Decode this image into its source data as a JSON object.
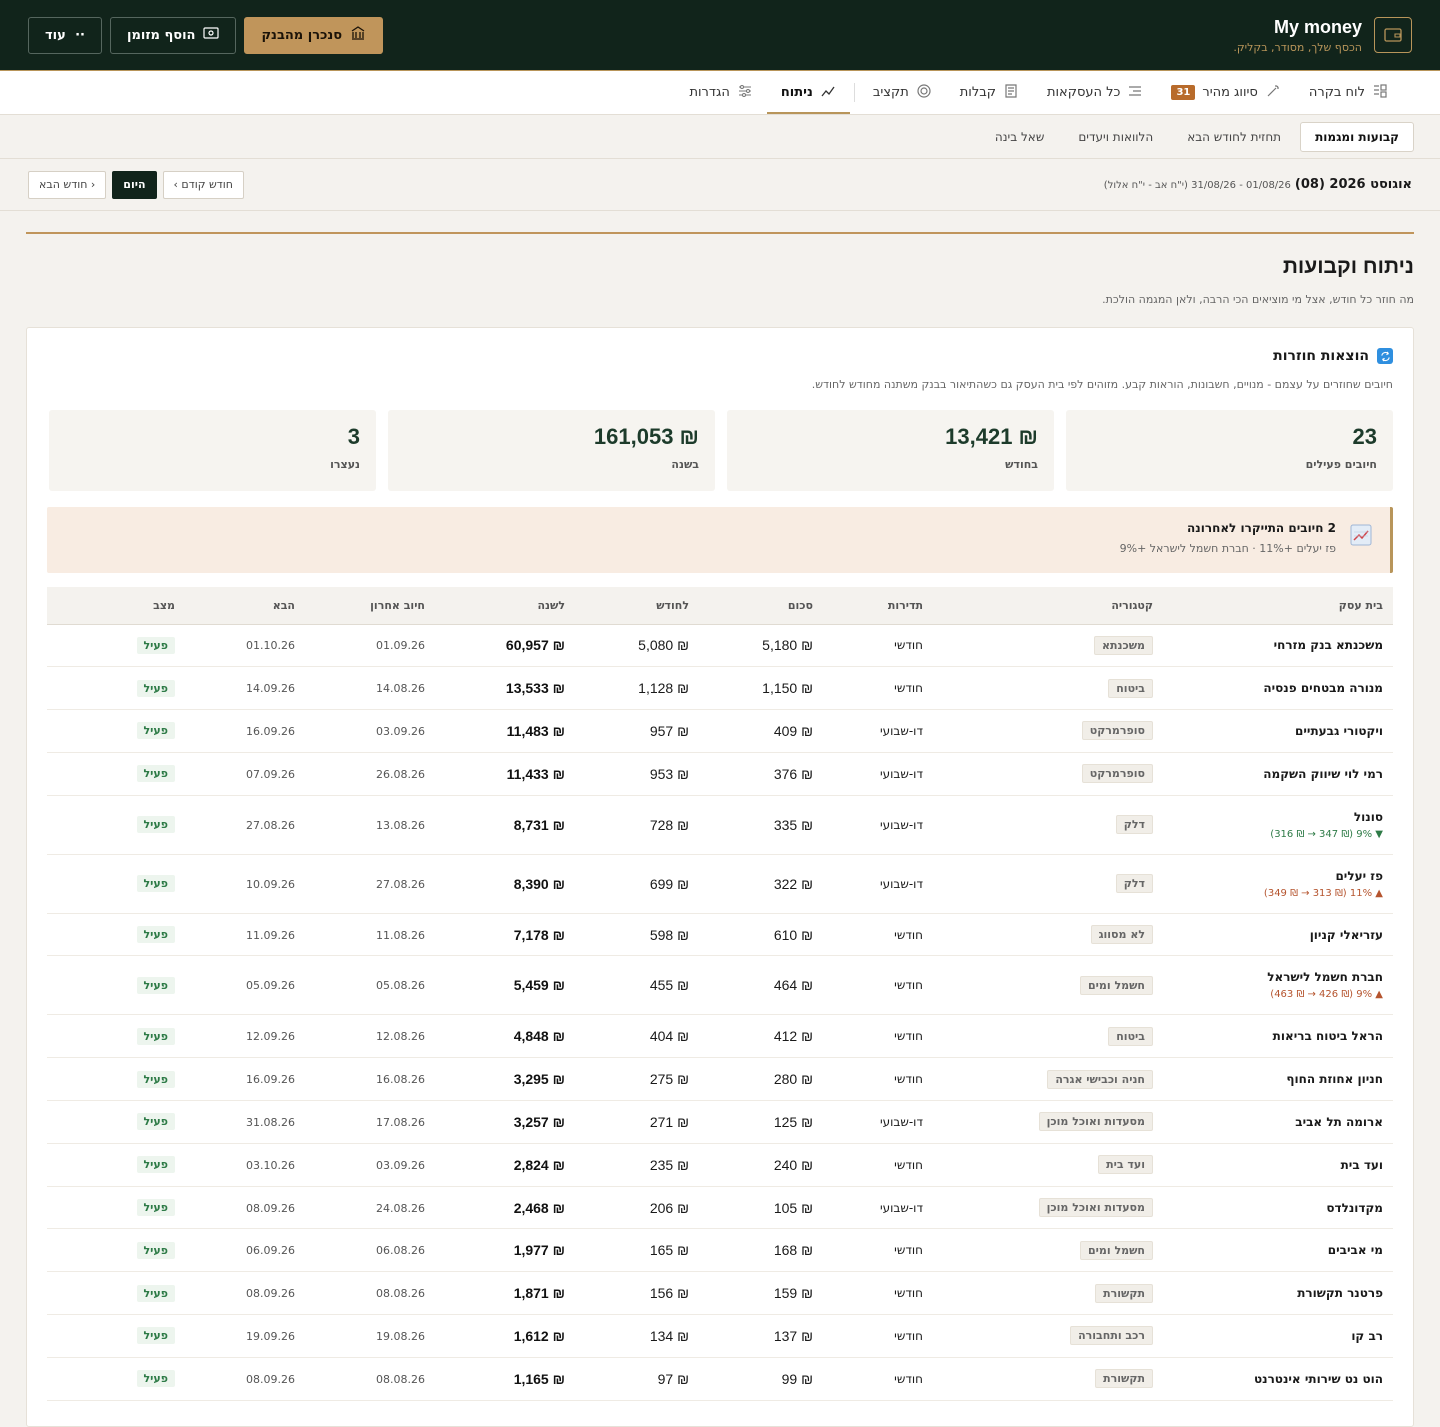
{
  "brand": {
    "title": "My money",
    "subtitle": "הכסף שלך, מסודר, בקליק."
  },
  "actions": {
    "sync": "סנכרן מהבנק",
    "cash": "הוסף מזומן",
    "more": "עוד"
  },
  "nav": {
    "dashboard": "לוח בקרה",
    "quick": "סיווג מהיר",
    "quick_count": "31",
    "all": "כל העסקאות",
    "receipts": "קבלות",
    "budget": "תקציב",
    "analysis": "ניתוח",
    "settings": "הגדרות"
  },
  "subnav": {
    "fixed": "קבועות ומגמות",
    "forecast": "תחזית לחודש הבא",
    "loans": "הלוואות ויעדים",
    "ask": "שאל בינה"
  },
  "datebar": {
    "month": "אוגוסט 2026 (08)",
    "range": "01/08/26 - 31/08/26 (י\"ח אב - י\"ח אלול)",
    "prev": "חודש קודם ›",
    "today": "היום",
    "next": "‹ חודש הבא"
  },
  "page": {
    "title": "ניתוח וקבועות",
    "subtitle": "מה חוזר כל חודש, אצל מי מוציאים הכי הרבה, ולאן המגמה הולכת."
  },
  "card": {
    "title": "הוצאות חוזרות",
    "subtitle": "חיובים שחוזרים על עצמם - מנויים, חשבונות, הוראות קבע. מזוהים לפי בית העסק גם כשהתיאור בבנק משתנה מחודש לחודש."
  },
  "stats": [
    {
      "value": "23",
      "label": "חיובים פעילים"
    },
    {
      "value": "₪ 13,421",
      "label": "בחודש"
    },
    {
      "value": "₪ 161,053",
      "label": "בשנה"
    },
    {
      "value": "3",
      "label": "נעצרו"
    }
  ],
  "alert": {
    "title": "2 חיובים התייקרו לאחרונה",
    "detail": "פז יעלים +11% · חברת חשמל לישראל +9%"
  },
  "table": {
    "headers": {
      "merchant": "בית עסק",
      "category": "קטגוריה",
      "freq": "תדירות",
      "amount": "סכום",
      "monthly": "לחודש",
      "yearly": "לשנה",
      "last": "חיוב אחרון",
      "next": "הבא",
      "status": "מצב"
    },
    "rows": [
      {
        "merchant": "משכנתא בנק מזרחי",
        "category": "משכנתא",
        "freq": "חודשי",
        "amount": "₪ 5,180",
        "monthly": "₪ 5,080",
        "yearly": "₪ 60,957",
        "last": "01.09.26",
        "next": "01.10.26",
        "status": "פעיל",
        "change": ""
      },
      {
        "merchant": "מנורה מבטחים פנסיה",
        "category": "ביטוח",
        "freq": "חודשי",
        "amount": "₪ 1,150",
        "monthly": "₪ 1,128",
        "yearly": "₪ 13,533",
        "last": "14.08.26",
        "next": "14.09.26",
        "status": "פעיל",
        "change": ""
      },
      {
        "merchant": "ויקטורי גבעתיים",
        "category": "סופרמרקט",
        "freq": "דו-שבועי",
        "amount": "₪ 409",
        "monthly": "₪ 957",
        "yearly": "₪ 11,483",
        "last": "03.09.26",
        "next": "16.09.26",
        "status": "פעיל",
        "change": ""
      },
      {
        "merchant": "רמי לוי שיווק השקמה",
        "category": "סופרמרקט",
        "freq": "דו-שבועי",
        "amount": "₪ 376",
        "monthly": "₪ 953",
        "yearly": "₪ 11,433",
        "last": "26.08.26",
        "next": "07.09.26",
        "status": "פעיל",
        "change": ""
      },
      {
        "merchant": "סונול",
        "category": "דלק",
        "freq": "דו-שבועי",
        "amount": "₪ 335",
        "monthly": "₪ 728",
        "yearly": "₪ 8,731",
        "last": "13.08.26",
        "next": "27.08.26",
        "status": "פעיל",
        "change": "▼ 9% (₪ 347 → ₪ 316)",
        "dir": "down"
      },
      {
        "merchant": "פז יעלים",
        "category": "דלק",
        "freq": "דו-שבועי",
        "amount": "₪ 322",
        "monthly": "₪ 699",
        "yearly": "₪ 8,390",
        "last": "27.08.26",
        "next": "10.09.26",
        "status": "פעיל",
        "change": "▲ 11% (₪ 313 → ₪ 349)",
        "dir": "up"
      },
      {
        "merchant": "עזריאלי קניון",
        "category": "לא מסווג",
        "freq": "חודשי",
        "amount": "₪ 610",
        "monthly": "₪ 598",
        "yearly": "₪ 7,178",
        "last": "11.08.26",
        "next": "11.09.26",
        "status": "פעיל",
        "change": ""
      },
      {
        "merchant": "חברת חשמל לישראל",
        "category": "חשמל ומים",
        "freq": "חודשי",
        "amount": "₪ 464",
        "monthly": "₪ 455",
        "yearly": "₪ 5,459",
        "last": "05.08.26",
        "next": "05.09.26",
        "status": "פעיל",
        "change": "▲ 9% (₪ 426 → ₪ 463)",
        "dir": "up"
      },
      {
        "merchant": "הראל ביטוח בריאות",
        "category": "ביטוח",
        "freq": "חודשי",
        "amount": "₪ 412",
        "monthly": "₪ 404",
        "yearly": "₪ 4,848",
        "last": "12.08.26",
        "next": "12.09.26",
        "status": "פעיל",
        "change": ""
      },
      {
        "merchant": "חניון אחוזת החוף",
        "category": "חניה וכבישי אגרה",
        "freq": "חודשי",
        "amount": "₪ 280",
        "monthly": "₪ 275",
        "yearly": "₪ 3,295",
        "last": "16.08.26",
        "next": "16.09.26",
        "status": "פעיל",
        "change": ""
      },
      {
        "merchant": "ארומה תל אביב",
        "category": "מסעדות ואוכל מוכן",
        "freq": "דו-שבועי",
        "amount": "₪ 125",
        "monthly": "₪ 271",
        "yearly": "₪ 3,257",
        "last": "17.08.26",
        "next": "31.08.26",
        "status": "פעיל",
        "change": ""
      },
      {
        "merchant": "ועד בית",
        "category": "ועד בית",
        "freq": "חודשי",
        "amount": "₪ 240",
        "monthly": "₪ 235",
        "yearly": "₪ 2,824",
        "last": "03.09.26",
        "next": "03.10.26",
        "status": "פעיל",
        "change": ""
      },
      {
        "merchant": "מקדונלדס",
        "category": "מסעדות ואוכל מוכן",
        "freq": "דו-שבועי",
        "amount": "₪ 105",
        "monthly": "₪ 206",
        "yearly": "₪ 2,468",
        "last": "24.08.26",
        "next": "08.09.26",
        "status": "פעיל",
        "change": ""
      },
      {
        "merchant": "מי אביבים",
        "category": "חשמל ומים",
        "freq": "חודשי",
        "amount": "₪ 168",
        "monthly": "₪ 165",
        "yearly": "₪ 1,977",
        "last": "06.08.26",
        "next": "06.09.26",
        "status": "פעיל",
        "change": ""
      },
      {
        "merchant": "פרטנר תקשורת",
        "category": "תקשורת",
        "freq": "חודשי",
        "amount": "₪ 159",
        "monthly": "₪ 156",
        "yearly": "₪ 1,871",
        "last": "08.08.26",
        "next": "08.09.26",
        "status": "פעיל",
        "change": ""
      },
      {
        "merchant": "רב קו",
        "category": "רכב ותחבורה",
        "freq": "חודשי",
        "amount": "₪ 137",
        "monthly": "₪ 134",
        "yearly": "₪ 1,612",
        "last": "19.08.26",
        "next": "19.09.26",
        "status": "פעיל",
        "change": ""
      },
      {
        "merchant": "הוט נט שירותי אינטרנט",
        "category": "תקשורת",
        "freq": "חודשי",
        "amount": "₪ 99",
        "monthly": "₪ 97",
        "yearly": "₪ 1,165",
        "last": "08.08.26",
        "next": "08.09.26",
        "status": "פעיל",
        "change": ""
      }
    ]
  }
}
